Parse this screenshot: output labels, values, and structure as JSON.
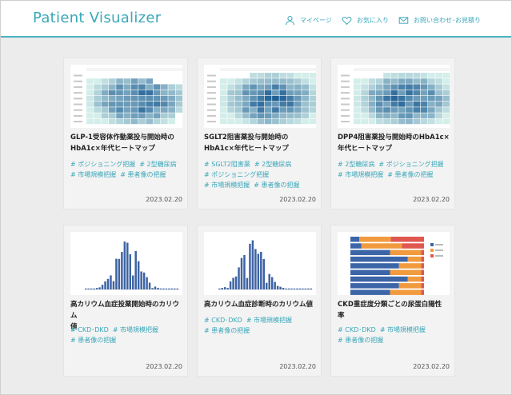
{
  "app": {
    "logo": "Patient Visualizer"
  },
  "nav": {
    "mypage": "マイページ",
    "favorites": "お気に入り",
    "contact": "お問い合わせ･お見積り"
  },
  "cards": [
    {
      "title_line1": "GLP-1受容体作動薬投与開始時の",
      "title_line2": "HbA1c×年代ヒートマップ",
      "tags": [
        "# ポジショニング把握",
        "# 2型糖尿病",
        "# 市場規模把握",
        "# 患者像の把握"
      ],
      "date": "2023.02.20",
      "thumb": "heatmap"
    },
    {
      "title_line1": "SGLT2阻害薬投与開始時の",
      "title_line2": "HbA1c×年代ヒートマップ",
      "tags": [
        "# SGLT2阻害薬",
        "# 2型糖尿病",
        "# ポジショニング把握",
        "# 市場規模把握",
        "# 患者像の把握"
      ],
      "date": "2023.02.20",
      "thumb": "heatmap"
    },
    {
      "title_line1": "DPP4阻害薬投与開始時のHbA1c×",
      "title_line2": "年代ヒートマップ",
      "tags": [
        "# 2型糖尿病",
        "# ポジショニング把握",
        "# 市場規模把握",
        "# 患者像の把握"
      ],
      "date": "2023.02.20",
      "thumb": "heatmap"
    },
    {
      "title_line1": "高カリウム血症投薬開始時のカリウム",
      "title_line2": "値",
      "tags": [
        "# CKD･DKD",
        "# 市場規模把握",
        "# 患者像の把握"
      ],
      "date": "2023.02.20",
      "thumb": "histogram"
    },
    {
      "title_line1": "高カリウム血症診断時のカリウム値",
      "title_line2": "",
      "tags": [
        "# CKD･DKD",
        "# 市場規模把握",
        "# 患者像の把握"
      ],
      "date": "2023.02.20",
      "thumb": "histogram"
    },
    {
      "title_line1": "CKD重症度分類ごとの尿蛋白陽性",
      "title_line2": "率",
      "tags": [
        "# CKD･DKD",
        "# 市場規模把握",
        "# 患者像の把握"
      ],
      "date": "2023.02.20",
      "thumb": "stacked-bar"
    }
  ],
  "colors": {
    "accent": "#3aa7b9",
    "heat_low": "#d4eeea",
    "heat_high": "#1d5e94",
    "bar": "#3d63a3",
    "stack_blue": "#3c65a8",
    "stack_orange": "#f19a3e",
    "stack_red": "#e0574f"
  }
}
